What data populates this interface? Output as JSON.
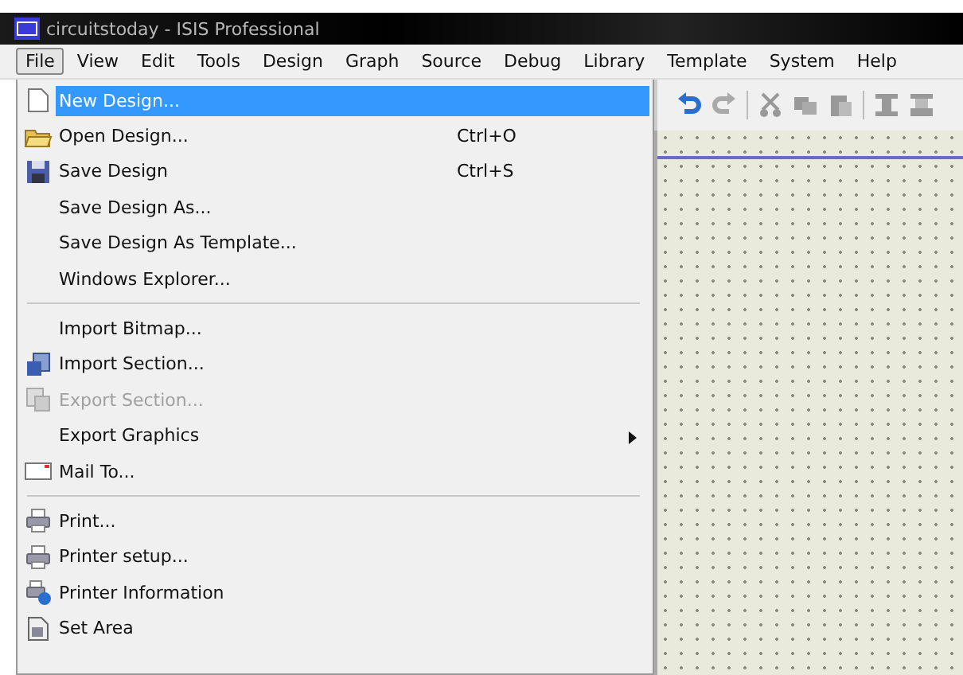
{
  "window": {
    "title": "circuitstoday - ISIS Professional"
  },
  "menubar": [
    {
      "label": "File",
      "selected": true
    },
    {
      "label": "View",
      "selected": false
    },
    {
      "label": "Edit",
      "selected": false
    },
    {
      "label": "Tools",
      "selected": false
    },
    {
      "label": "Design",
      "selected": false
    },
    {
      "label": "Graph",
      "selected": false
    },
    {
      "label": "Source",
      "selected": false
    },
    {
      "label": "Debug",
      "selected": false
    },
    {
      "label": "Library",
      "selected": false
    },
    {
      "label": "Template",
      "selected": false
    },
    {
      "label": "System",
      "selected": false
    },
    {
      "label": "Help",
      "selected": false
    }
  ],
  "file_menu": [
    {
      "kind": "item",
      "label": "New Design...",
      "selected": true,
      "disabled": false
    },
    {
      "kind": "item",
      "label": "Open Design...",
      "shortcut": "Ctrl+O",
      "selected": false,
      "disabled": false
    },
    {
      "kind": "item",
      "label": "Save Design",
      "shortcut": "Ctrl+S",
      "selected": false,
      "disabled": false
    },
    {
      "kind": "item",
      "label": "Save Design As...",
      "selected": false,
      "disabled": false
    },
    {
      "kind": "item",
      "label": "Save Design As Template...",
      "selected": false,
      "disabled": false
    },
    {
      "kind": "item",
      "label": "Windows Explorer...",
      "selected": false,
      "disabled": false
    },
    {
      "kind": "separator"
    },
    {
      "kind": "item",
      "label": "Import Bitmap...",
      "selected": false,
      "disabled": false
    },
    {
      "kind": "item",
      "label": "Import Section...",
      "selected": false,
      "disabled": false
    },
    {
      "kind": "item",
      "label": "Export Section...",
      "selected": false,
      "disabled": true
    },
    {
      "kind": "item",
      "label": "Export Graphics",
      "selected": false,
      "disabled": false,
      "submenu": true
    },
    {
      "kind": "item",
      "label": "Mail To...",
      "selected": false,
      "disabled": false
    },
    {
      "kind": "separator"
    },
    {
      "kind": "item",
      "label": "Print...",
      "selected": false,
      "disabled": false
    },
    {
      "kind": "item",
      "label": "Printer setup...",
      "selected": false,
      "disabled": false
    },
    {
      "kind": "item",
      "label": "Printer Information",
      "selected": false,
      "disabled": false
    },
    {
      "kind": "item",
      "label": "Set Area",
      "selected": false,
      "disabled": false
    }
  ]
}
